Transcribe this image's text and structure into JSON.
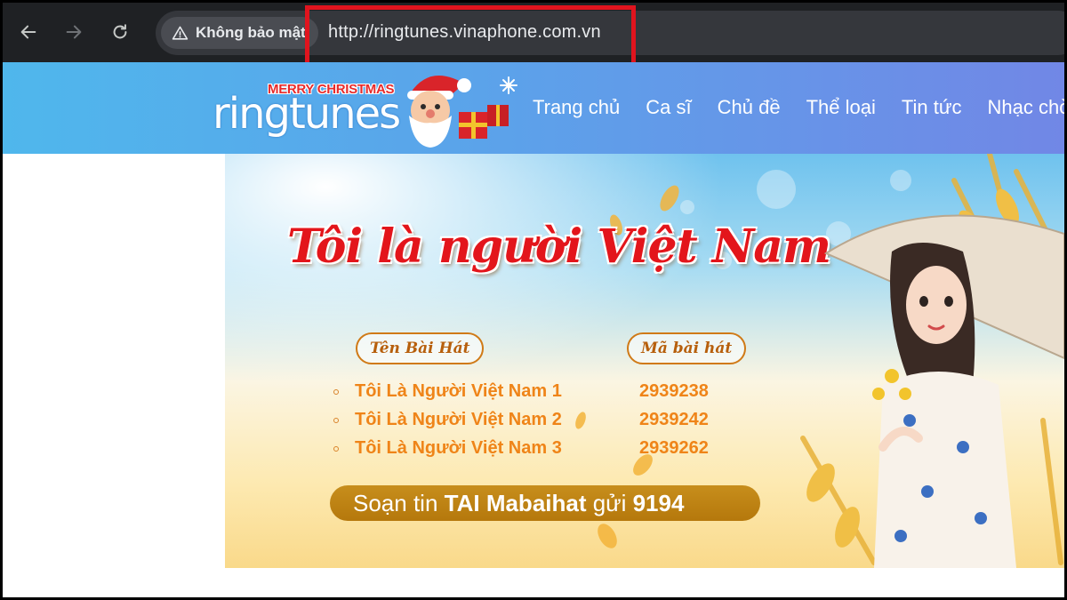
{
  "browser": {
    "security_label": "Không bảo mật",
    "url": "http://ringtunes.vinaphone.com.vn",
    "icons": [
      "back-arrow-icon",
      "forward-arrow-icon",
      "reload-icon",
      "warning-triangle-icon"
    ],
    "highlight_color": "#e0141e"
  },
  "site": {
    "logo": {
      "badge": "MERRY CHRISTMAS",
      "wordmark": "ringtunes"
    },
    "nav": [
      {
        "label": "Trang chủ"
      },
      {
        "label": "Ca sĩ"
      },
      {
        "label": "Chủ đề"
      },
      {
        "label": "Thể loại"
      },
      {
        "label": "Tin tức"
      },
      {
        "label": "Nhạc chờ"
      }
    ],
    "header_gradient": [
      "#4fb7ec",
      "#7187e6"
    ]
  },
  "banner": {
    "title": "Tôi là người Việt Nam",
    "col_song_header": "Tên Bài Hát",
    "col_code_header": "Mã bài hát",
    "songs": [
      {
        "name": "Tôi Là Người Việt Nam 1",
        "code": "2939238"
      },
      {
        "name": "Tôi Là Người Việt Nam 2",
        "code": "2939242"
      },
      {
        "name": "Tôi Là Người Việt Nam 3",
        "code": "2939262"
      }
    ],
    "sms": {
      "prefix": "Soạn tin ",
      "keyword": "TAI Mabaihat",
      "middle": " gửi ",
      "number": "9194"
    },
    "accent_red": "#e3151b",
    "accent_orange": "#ef8418"
  }
}
